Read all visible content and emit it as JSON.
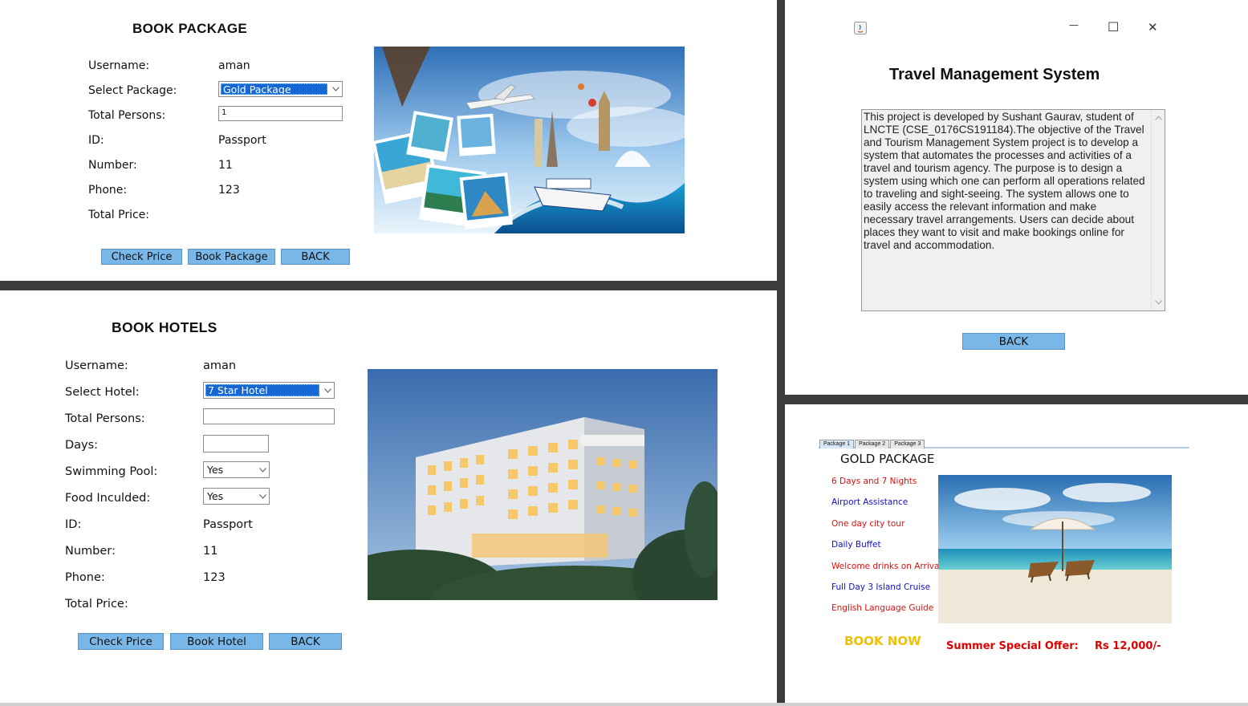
{
  "book_package": {
    "title": "BOOK PACKAGE",
    "fields": [
      {
        "label": "Username:",
        "value": "aman"
      },
      {
        "label": "Select Package:",
        "value": "Gold Package"
      },
      {
        "label": "Total Persons:",
        "value": "1"
      },
      {
        "label": "ID:",
        "value": "Passport"
      },
      {
        "label": "Number:",
        "value": "11"
      },
      {
        "label": "Phone:",
        "value": "123"
      },
      {
        "label": "Total Price:",
        "value": ""
      }
    ],
    "buttons": {
      "check": "Check Price",
      "book": "Book Package",
      "back": "BACK"
    }
  },
  "about": {
    "title": "Travel Management System",
    "text": "This project is developed by Sushant Gaurav, student of LNCTE (CSE_0176CS191184).The objective of the Travel and Tourism Management System project is to develop a system that automates the processes and activities of a travel and tourism agency. The purpose is to design a system using which one can perform all operations related to traveling and sight-seeing. The system allows one to easily access the relevant information and make necessary travel arrangements. Users can decide about places they want to visit and make bookings online for travel and accommodation.",
    "back": "BACK",
    "window_controls": {
      "minimize": "—",
      "maximize": "☐",
      "close": "✕"
    }
  },
  "book_hotels": {
    "title": "BOOK HOTELS",
    "fields": [
      {
        "label": "Username:",
        "value": "aman"
      },
      {
        "label": "Select Hotel:",
        "value": "7 Star Hotel"
      },
      {
        "label": "Total Persons:",
        "value": ""
      },
      {
        "label": "Days:",
        "value": ""
      },
      {
        "label": "Swimming Pool:",
        "value": "Yes"
      },
      {
        "label": "Food Inculded:",
        "value": "Yes"
      },
      {
        "label": "ID:",
        "value": "Passport"
      },
      {
        "label": "Number:",
        "value": "11"
      },
      {
        "label": "Phone:",
        "value": "123"
      },
      {
        "label": "Total Price:",
        "value": ""
      }
    ],
    "buttons": {
      "check": "Check Price",
      "book": "Book Hotel",
      "back": "BACK"
    }
  },
  "gold_package": {
    "tabs": [
      "Package 1",
      "Package 2",
      "Package 3"
    ],
    "title": "GOLD PACKAGE",
    "features": [
      {
        "text": "6 Days and 7 Nights",
        "color": "#e01010"
      },
      {
        "text": "Airport Assistance",
        "color": "#1010c8"
      },
      {
        "text": "One day city tour",
        "color": "#e01010"
      },
      {
        "text": "Daily Buffet",
        "color": "#1010c8"
      },
      {
        "text": "Welcome drinks on Arrival",
        "color": "#e01010"
      },
      {
        "text": "Full Day 3 Island Cruise",
        "color": "#1010c8"
      },
      {
        "text": "English Language Guide",
        "color": "#e01010"
      }
    ],
    "book_now": "BOOK NOW",
    "offer_label": "Summer Special Offer:",
    "price": "Rs 12,000/-",
    "colors": {
      "book_now": "#f0c000",
      "offer": "#e00000",
      "button": "#78b7e8"
    }
  }
}
